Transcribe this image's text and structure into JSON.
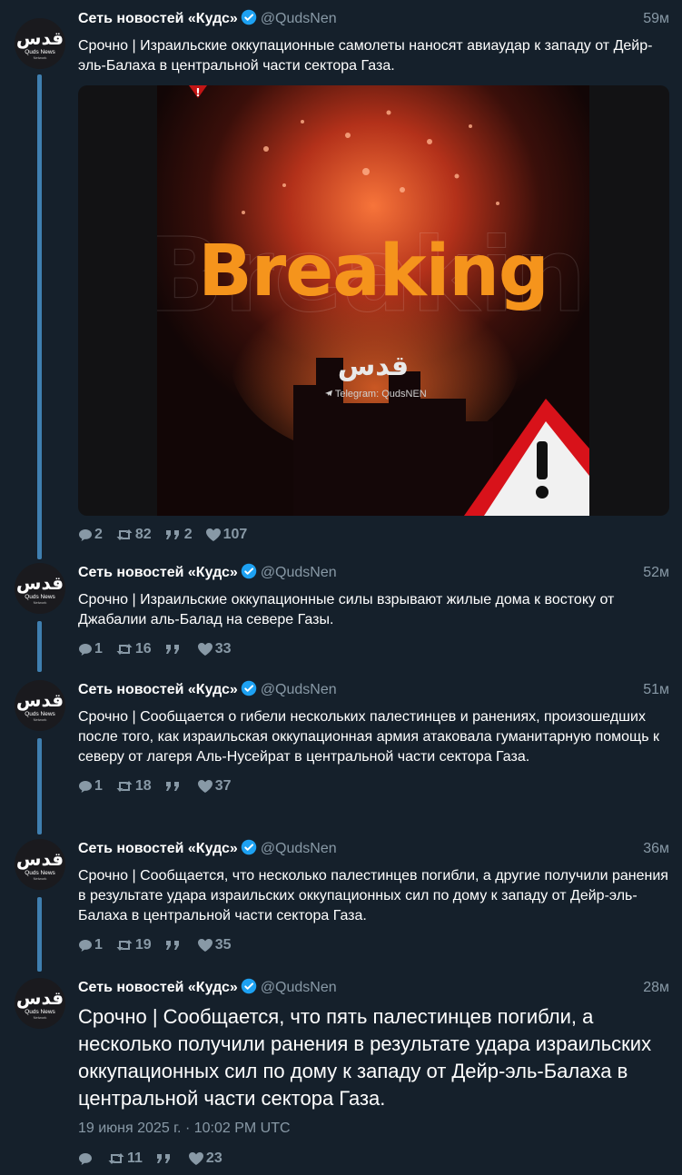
{
  "account": {
    "name": "Сеть новостей «Кудс»",
    "handle": "@QudsNen",
    "avatar_text": "قدس",
    "avatar_sub": "Quds News",
    "avatar_sub2": "Network"
  },
  "colors": {
    "background": "#15202b",
    "thread_line": "#3f7fb0",
    "verified": "#1da1f2",
    "muted": "#8899a6",
    "breaking": "#f5941c"
  },
  "media": {
    "headline": "Breaking",
    "logo": "قدس",
    "telegram": "Telegram: QudsNEN"
  },
  "tweets": [
    {
      "time": "59м",
      "text": "Срочно | Израильские оккупационные самолеты наносят авиаудар к западу от Дейр-эль-Балаха в центральной части сектора Газа.",
      "replies": "2",
      "retweets": "82",
      "quotes": "2",
      "likes": "107"
    },
    {
      "time": "52м",
      "text": "Срочно | Израильские оккупационные силы взрывают жилые дома к востоку от Джабалии аль-Балад на севере Газы.",
      "replies": "1",
      "retweets": "16",
      "quotes": "",
      "likes": "33"
    },
    {
      "time": "51м",
      "text": "Срочно | Сообщается о гибели нескольких палестинцев и ранениях, произошедших после того, как израильская оккупационная армия атаковала гуманитарную помощь к северу от лагеря Аль-Нусейрат в центральной части сектора Газа.",
      "replies": "1",
      "retweets": "18",
      "quotes": "",
      "likes": "37"
    },
    {
      "time": "36м",
      "text": "Срочно | Сообщается, что несколько палестинцев погибли, а другие получили ранения в результате удара израильских оккупационных сил по дому к западу от Дейр-эль-Балаха в центральной части сектора Газа.",
      "replies": "1",
      "retweets": "19",
      "quotes": "",
      "likes": "35"
    },
    {
      "time": "28м",
      "text": "Срочно | Сообщается, что пять палестинцев погибли, а несколько получили ранения в результате удара израильских оккупационных сил по дому к западу от Дейр-эль-Балаха в центральной части сектора Газа.",
      "date": "19 июня 2025 г. · 10:02 PM UTC",
      "replies": "",
      "retweets": "11",
      "quotes": "",
      "likes": "23"
    }
  ]
}
